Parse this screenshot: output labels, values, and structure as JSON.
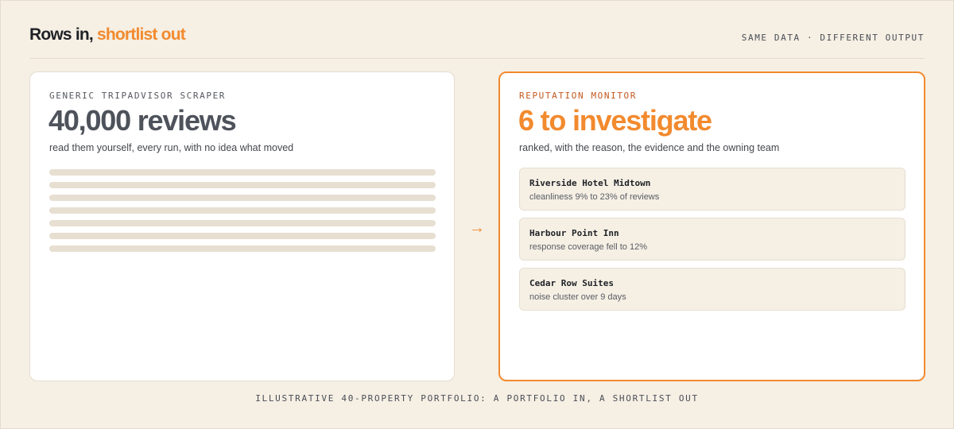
{
  "header": {
    "title_main": "Rows in,",
    "title_accent": " shortlist out",
    "tagline": "SAME DATA · DIFFERENT OUTPUT"
  },
  "left_card": {
    "eyebrow": "GENERIC TRIPADVISOR SCRAPER",
    "headline": "40,000 reviews",
    "subtitle": "read them yourself, every run, with no idea what moved",
    "placeholder_line_count": 7
  },
  "arrow": "→",
  "right_card": {
    "eyebrow": "REPUTATION MONITOR",
    "headline": "6 to investigate",
    "subtitle": "ranked, with the reason, the evidence and the owning team",
    "items": [
      {
        "name": "Riverside Hotel Midtown",
        "reason": "cleanliness 9% to 23% of reviews"
      },
      {
        "name": "Harbour Point Inn",
        "reason": "response coverage fell to 12%"
      },
      {
        "name": "Cedar Row Suites",
        "reason": "noise cluster over 9 days"
      }
    ]
  },
  "footer": "ILLUSTRATIVE 40-PROPERTY PORTFOLIO: A PORTFOLIO IN, A SHORTLIST OUT",
  "colors": {
    "accent": "#f28a2e",
    "background": "#f5efe4",
    "card": "#ffffff"
  }
}
